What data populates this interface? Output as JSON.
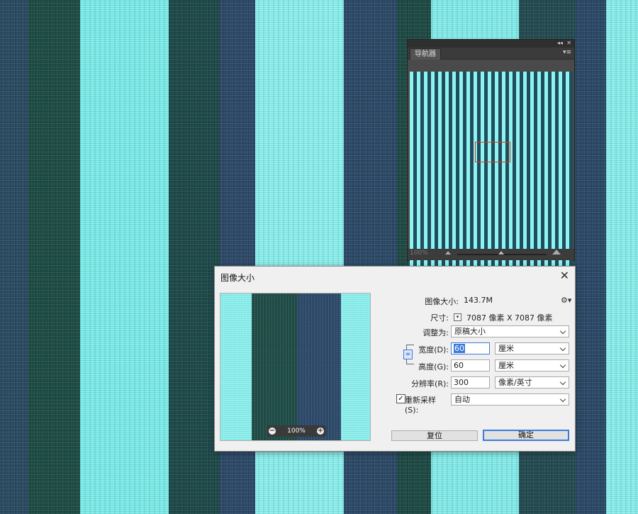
{
  "navigator": {
    "tab": "导航器",
    "zoom": "100%"
  },
  "dialog": {
    "title": "图像大小",
    "close": "✕",
    "preview_zoom": "100%",
    "image_size_label": "图像大小:",
    "image_size_value": "143.7M",
    "dimensions_label": "尺寸:",
    "dimensions_value": "7087 像素  X  7087 像素",
    "fit_to_label": "调整为:",
    "fit_to_value": "原稿大小",
    "width_label": "宽度(D):",
    "width_value": "60",
    "width_unit": "厘米",
    "height_label": "高度(G):",
    "height_value": "60",
    "height_unit": "厘米",
    "resolution_label": "分辨率(R):",
    "resolution_value": "300",
    "resolution_unit": "像素/英寸",
    "resample_label": "重新采样(S):",
    "resample_checked": true,
    "resample_value": "自动",
    "reset_button": "复位",
    "ok_button": "确定"
  },
  "icons": {
    "gear": "gear-icon",
    "link": "link-icon",
    "zoom_out": "zoom-out-icon",
    "zoom_in": "zoom-in-icon"
  },
  "colors": {
    "accent": "#3d7bd9",
    "nav_view_rect": "#e0391d",
    "stripe_light": "#8ef3f1",
    "stripe_dark": "#2b4968"
  }
}
